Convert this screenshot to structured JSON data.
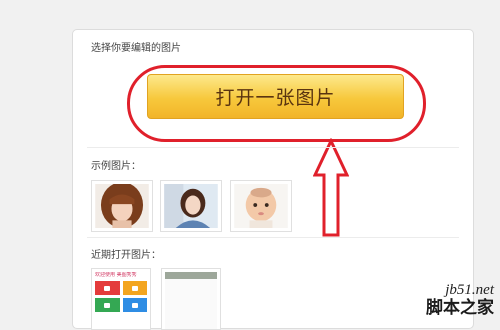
{
  "panel": {
    "select_label": "选择你要编辑的图片",
    "open_button_label": "打开一张图片",
    "examples_label": "示例图片：",
    "recent_label": "近期打开图片："
  },
  "examples": [
    {
      "name": "example-photo-woman-bangs"
    },
    {
      "name": "example-photo-girl-denim"
    },
    {
      "name": "example-photo-baby"
    }
  ],
  "recent": [
    {
      "name": "recent-image-app-screenshot",
      "caption": "欢迎使用 美图秀秀"
    },
    {
      "name": "recent-image-blank"
    }
  ],
  "annotation": {
    "oval_color": "#e0202b",
    "arrow_color": "#e0202b",
    "arrow_icon": "red-up-arrow-icon"
  },
  "watermark": {
    "url": "jb51.net",
    "name": "脚本之家"
  }
}
